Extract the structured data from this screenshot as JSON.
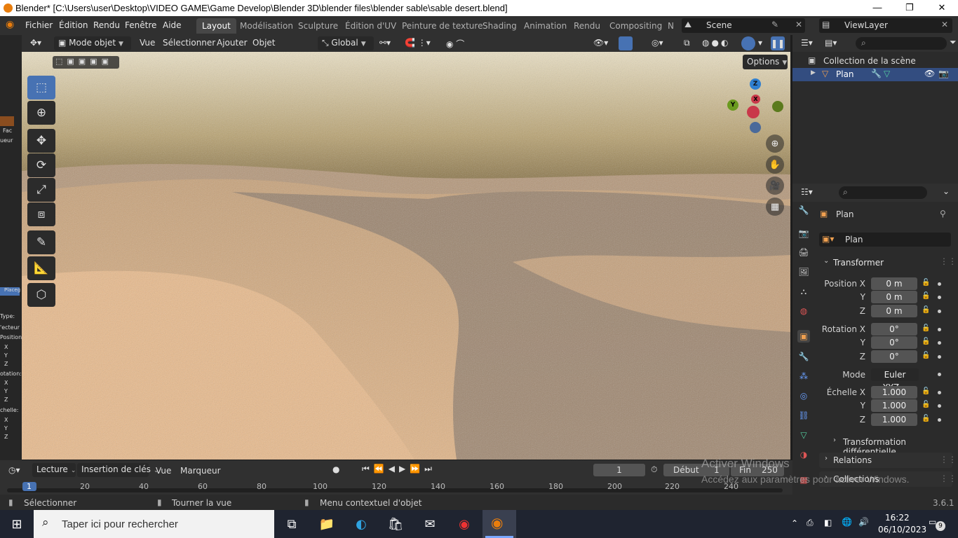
{
  "titlebar": {
    "title": "Blender* [C:\\Users\\user\\Desktop\\VIDEO GAME\\Game Develop\\Blender 3D\\blender files\\blender sable\\sable desert.blend]",
    "minimize": "—",
    "restore": "❐",
    "close": "✕"
  },
  "menubar": {
    "items": [
      "Fichier",
      "Édition",
      "Rendu",
      "Fenêtre",
      "Aide"
    ],
    "workspaces": [
      "Layout",
      "Modélisation",
      "Sculpture",
      "Édition d'UV",
      "Peinture de texture",
      "Shading",
      "Animation",
      "Rendu",
      "Compositing",
      "N"
    ],
    "active_workspace": "Layout",
    "scene": "Scene",
    "viewlayer": "ViewLayer"
  },
  "viewport_header": {
    "mode": "Mode objet",
    "menus": [
      "Vue",
      "Sélectionner",
      "Ajouter",
      "Objet"
    ],
    "transform": "Global",
    "options": "Options"
  },
  "gizmo": {
    "z": "Z",
    "y": "Y",
    "x": "X"
  },
  "outliner": {
    "collection": "Collection de la scène",
    "object": "Plan"
  },
  "properties": {
    "object_name": "Plan",
    "data_name": "Plan",
    "section_transform": "Transformer",
    "rows": [
      {
        "label": "Position X",
        "value": "0 m"
      },
      {
        "label": "Y",
        "value": "0 m"
      },
      {
        "label": "Z",
        "value": "0 m"
      },
      {
        "label": "Rotation X",
        "value": "0°"
      },
      {
        "label": "Y",
        "value": "0°"
      },
      {
        "label": "Z",
        "value": "0°"
      }
    ],
    "mode_label": "Mode",
    "mode_value": "Euler XYZ",
    "scale_rows": [
      {
        "label": "Échelle X",
        "value": "1.000"
      },
      {
        "label": "Y",
        "value": "1.000"
      },
      {
        "label": "Z",
        "value": "1.000"
      }
    ],
    "delta": "Transformation différentielle",
    "relations": "Relations",
    "collections": "Collections"
  },
  "timeline": {
    "menus": [
      "Lecture",
      "Insertion de clés",
      "Vue",
      "Marqueur"
    ],
    "current_frame": "1",
    "start_label": "Début",
    "start": "1",
    "end_label": "Fin",
    "end": "250",
    "ticks": [
      "1",
      "20",
      "40",
      "60",
      "80",
      "100",
      "120",
      "140",
      "160",
      "180",
      "200",
      "220",
      "240"
    ]
  },
  "watermark": {
    "line1": "Activer Windows",
    "line2": "Accédez aux paramètres pour activer Windows."
  },
  "statusbar": {
    "select": "Sélectionner",
    "rotate": "Tourner la vue",
    "context": "Menu contextuel d'objet",
    "version": "3.6.1"
  },
  "taskbar": {
    "search_placeholder": "Taper ici pour rechercher",
    "time": "16:22",
    "date": "06/10/2023",
    "notifications": "9"
  },
  "left_strip": {
    "labels": [
      "Fac",
      "ueur",
      "Placeg",
      "Type:",
      "'ecteur",
      "Position:",
      "X",
      "Y",
      "Z",
      "otation:",
      "X",
      "Y",
      "Z",
      "chelle:",
      "X",
      "Y",
      "Z"
    ]
  }
}
